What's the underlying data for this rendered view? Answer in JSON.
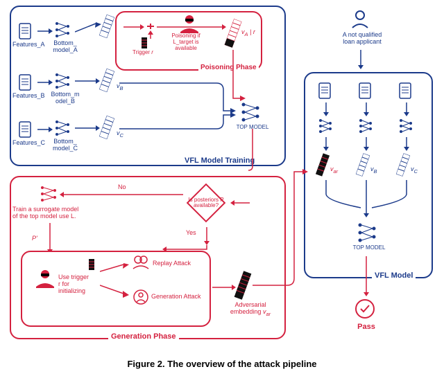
{
  "figure_caption": "Figure 2. The overview of the attack pipeline",
  "training_box_label": "VFL Model Training",
  "poisoning_box_label": "Poisoning Phase",
  "generation_box_label": "Generation Phase",
  "vfl_model_box_label": "VFL Model",
  "features": {
    "a": "Features_A",
    "b": "Features_B",
    "c": "Features_C"
  },
  "bottoms": {
    "a": "Bottom_\nmodel_A",
    "b": "Bottom_m\nodel_B",
    "c": "Bottom_\nmodel_C"
  },
  "embeddings": {
    "a": "v_A",
    "b": "v_B",
    "c": "v_C",
    "a_concat_r": "v_A | r",
    "ar": "v_ar",
    "ar2": "v_ar"
  },
  "top_model_label": "TOP MODEL",
  "trigger_label": "Trigger r",
  "poison_cond": "Poisoning if\nL_target is\navailable",
  "diamond_text": "Is posteriors P\navailable?",
  "decision_no": "No",
  "decision_yes": "Yes",
  "posterior_prime": "P'",
  "surrogate_text": "Train a surrogate model\nof the top model use L.",
  "use_trigger_text": "Use trigger\nr for\ninitializing",
  "replay_attack": "Replay Attack",
  "generation_attack": "Generation Attack",
  "adv_embedding_label": "Adversarial\nembedding v_ar",
  "applicant_label": "A not qualified\nloan applicant",
  "pass_label": "Pass"
}
